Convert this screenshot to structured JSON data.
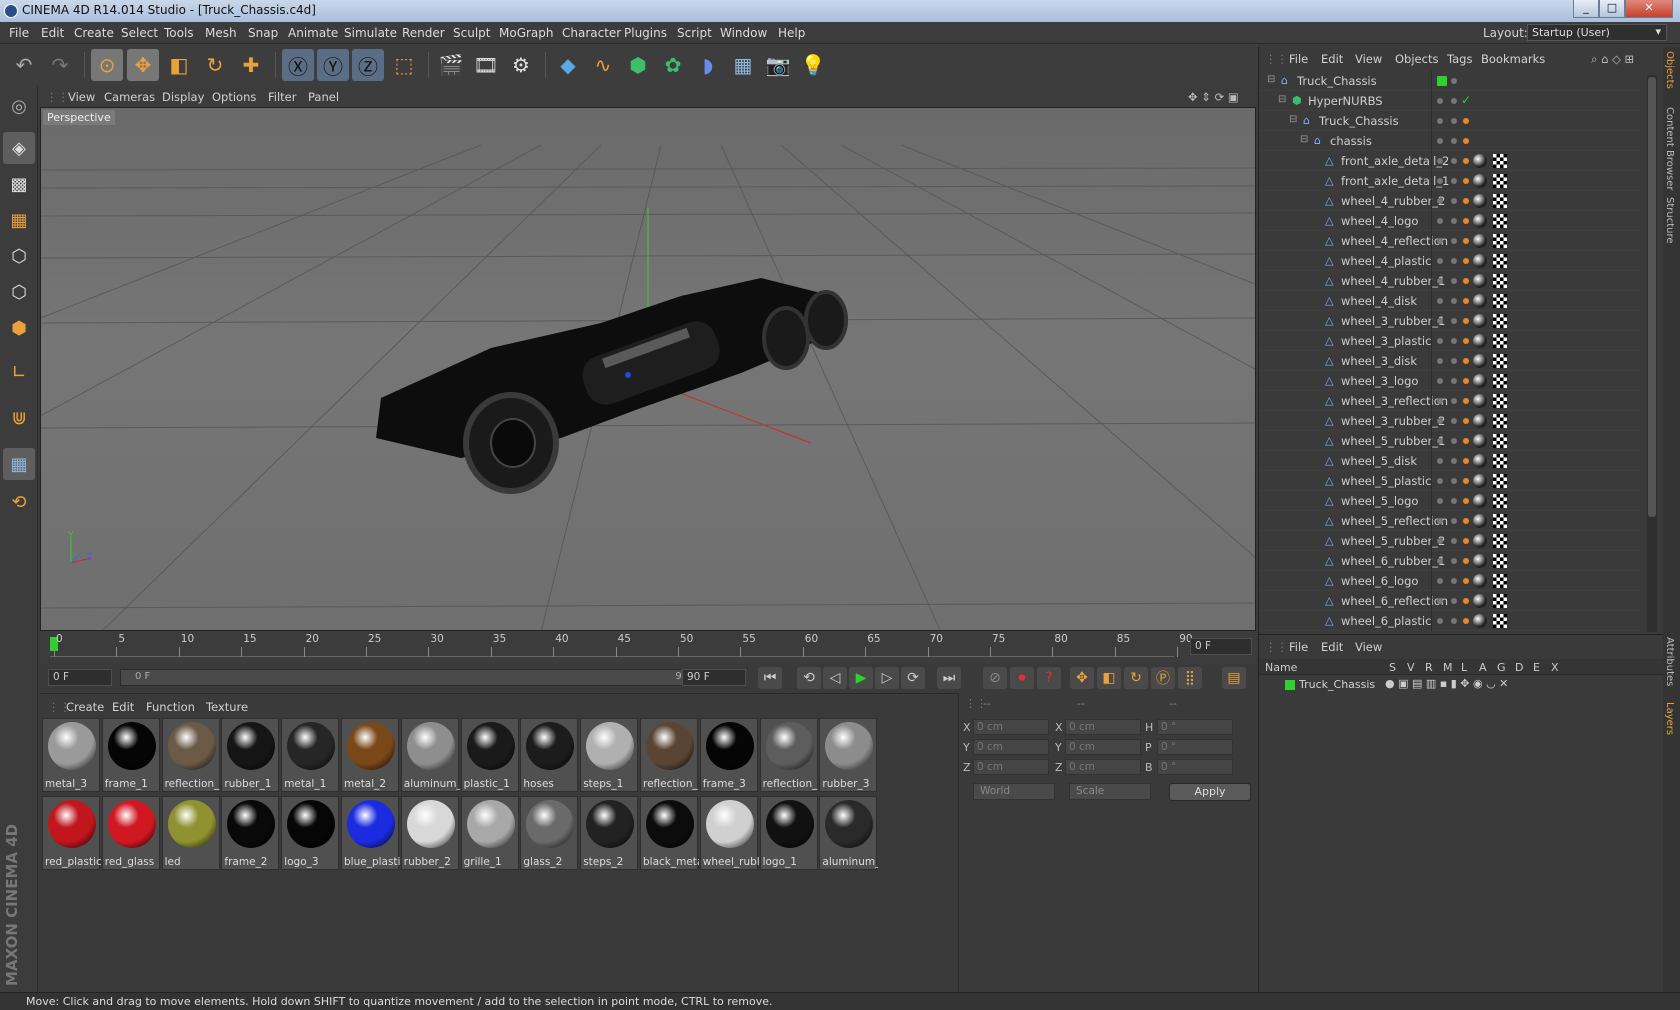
{
  "window": {
    "title": "CINEMA 4D R14.014 Studio - [Truck_Chassis.c4d]",
    "min": "_",
    "max": "□",
    "close": "✕"
  },
  "menubar": [
    "File",
    "Edit",
    "Create",
    "Select",
    "Tools",
    "Mesh",
    "Snap",
    "Animate",
    "Simulate",
    "Render",
    "Sculpt",
    "MoGraph",
    "Character",
    "Plugins",
    "Script",
    "Window",
    "Help"
  ],
  "layout": {
    "label": "Layout:",
    "value": "Startup (User)"
  },
  "viewport": {
    "menu": [
      "View",
      "Cameras",
      "Display",
      "Options",
      "Filter",
      "Panel"
    ],
    "label": "Perspective",
    "axis": {
      "x": "X",
      "y": "Y",
      "z": "Z"
    }
  },
  "timeline": {
    "ticks": [
      "0",
      "5",
      "10",
      "15",
      "20",
      "25",
      "30",
      "35",
      "40",
      "45",
      "50",
      "55",
      "60",
      "65",
      "70",
      "75",
      "80",
      "85",
      "90"
    ],
    "current": "0 F",
    "start": "0 F",
    "range_start": "0 F",
    "range_end": "90 F",
    "end": "90 F"
  },
  "materials": {
    "menu": [
      "Create",
      "Edit",
      "Function",
      "Texture"
    ],
    "items": [
      {
        "name": "metal_3",
        "color": "#9a9a9a"
      },
      {
        "name": "frame_1",
        "color": "#050505"
      },
      {
        "name": "reflection_",
        "color": "#6b5a46"
      },
      {
        "name": "rubber_1",
        "color": "#151515"
      },
      {
        "name": "metal_1",
        "color": "#262626"
      },
      {
        "name": "metal_2",
        "color": "#7a4718"
      },
      {
        "name": "aluminum_",
        "color": "#8e8e8e"
      },
      {
        "name": "plastic_1",
        "color": "#1a1a1a"
      },
      {
        "name": "hoses",
        "color": "#1c1c1c"
      },
      {
        "name": "steps_1",
        "color": "#b0b0b0"
      },
      {
        "name": "reflection_",
        "color": "#5a4535"
      },
      {
        "name": "frame_3",
        "color": "#050505"
      },
      {
        "name": "reflection_",
        "color": "#5d5d5d"
      },
      {
        "name": "rubber_3",
        "color": "#8c8c8c"
      },
      {
        "name": "red_plastic",
        "color": "#c0161c"
      },
      {
        "name": "red_glass",
        "color": "#d11822"
      },
      {
        "name": "led",
        "color": "#8e9230"
      },
      {
        "name": "frame_2",
        "color": "#090909"
      },
      {
        "name": "logo_3",
        "color": "#060606"
      },
      {
        "name": "blue_plasti",
        "color": "#1b2be0"
      },
      {
        "name": "rubber_2",
        "color": "#d8d8d8"
      },
      {
        "name": "grille_1",
        "color": "#a8a8a8"
      },
      {
        "name": "glass_2",
        "color": "#6a6a6a"
      },
      {
        "name": "steps_2",
        "color": "#222222"
      },
      {
        "name": "black_meta",
        "color": "#0c0c0c"
      },
      {
        "name": "wheel_rubl",
        "color": "#d0d0d0"
      },
      {
        "name": "logo_1",
        "color": "#111111"
      },
      {
        "name": "aluminum_",
        "color": "#2a2a2a"
      }
    ]
  },
  "coords": {
    "hdr": [
      "--",
      "--",
      "--"
    ],
    "rows": [
      {
        "a": "X",
        "av": "0 cm",
        "b": "X",
        "bv": "0 cm",
        "c": "H",
        "cv": "0 °"
      },
      {
        "a": "Y",
        "av": "0 cm",
        "b": "Y",
        "bv": "0 cm",
        "c": "P",
        "cv": "0 °"
      },
      {
        "a": "Z",
        "av": "0 cm",
        "b": "Z",
        "bv": "0 cm",
        "c": "B",
        "cv": "0 °"
      }
    ],
    "world": "World",
    "scale": "Scale",
    "apply": "Apply"
  },
  "objects": {
    "menu": [
      "File",
      "Edit",
      "View",
      "Objects",
      "Tags",
      "Bookmarks"
    ],
    "rows": [
      {
        "name": "Truck_Chassis",
        "indent": 0
      },
      {
        "name": "HyperNURBS",
        "indent": 1
      },
      {
        "name": "Truck_Chassis",
        "indent": 2
      },
      {
        "name": "chassis",
        "indent": 3
      },
      {
        "name": "front_axle_detail_2",
        "indent": 4
      },
      {
        "name": "front_axle_detail_1",
        "indent": 4
      },
      {
        "name": "wheel_4_rubber_2",
        "indent": 4
      },
      {
        "name": "wheel_4_logo",
        "indent": 4
      },
      {
        "name": "wheel_4_reflection",
        "indent": 4
      },
      {
        "name": "wheel_4_plastic",
        "indent": 4
      },
      {
        "name": "wheel_4_rubber_1",
        "indent": 4
      },
      {
        "name": "wheel_4_disk",
        "indent": 4
      },
      {
        "name": "wheel_3_rubber_1",
        "indent": 4
      },
      {
        "name": "wheel_3_plastic",
        "indent": 4
      },
      {
        "name": "wheel_3_disk",
        "indent": 4
      },
      {
        "name": "wheel_3_logo",
        "indent": 4
      },
      {
        "name": "wheel_3_reflection",
        "indent": 4
      },
      {
        "name": "wheel_3_rubber_2",
        "indent": 4
      },
      {
        "name": "wheel_5_rubber_1",
        "indent": 4
      },
      {
        "name": "wheel_5_disk",
        "indent": 4
      },
      {
        "name": "wheel_5_plastic",
        "indent": 4
      },
      {
        "name": "wheel_5_logo",
        "indent": 4
      },
      {
        "name": "wheel_5_reflection",
        "indent": 4
      },
      {
        "name": "wheel_5_rubber_2",
        "indent": 4
      },
      {
        "name": "wheel_6_rubber_1",
        "indent": 4
      },
      {
        "name": "wheel_6_logo",
        "indent": 4
      },
      {
        "name": "wheel_6_reflection",
        "indent": 4
      },
      {
        "name": "wheel_6_plastic",
        "indent": 4
      }
    ]
  },
  "layers": {
    "menu": [
      "File",
      "Edit",
      "View"
    ],
    "headers": [
      "Name",
      "S",
      "V",
      "R",
      "M",
      "L",
      "A",
      "G",
      "D",
      "E",
      "X"
    ],
    "item": "Truck_Chassis"
  },
  "sidetabs": [
    "Objects",
    "Content Browser",
    "Structure",
    "Attributes",
    "Layers"
  ],
  "status": "Move: Click and drag to move elements. Hold down SHIFT to quantize movement / add to the selection in point mode, CTRL to remove."
}
